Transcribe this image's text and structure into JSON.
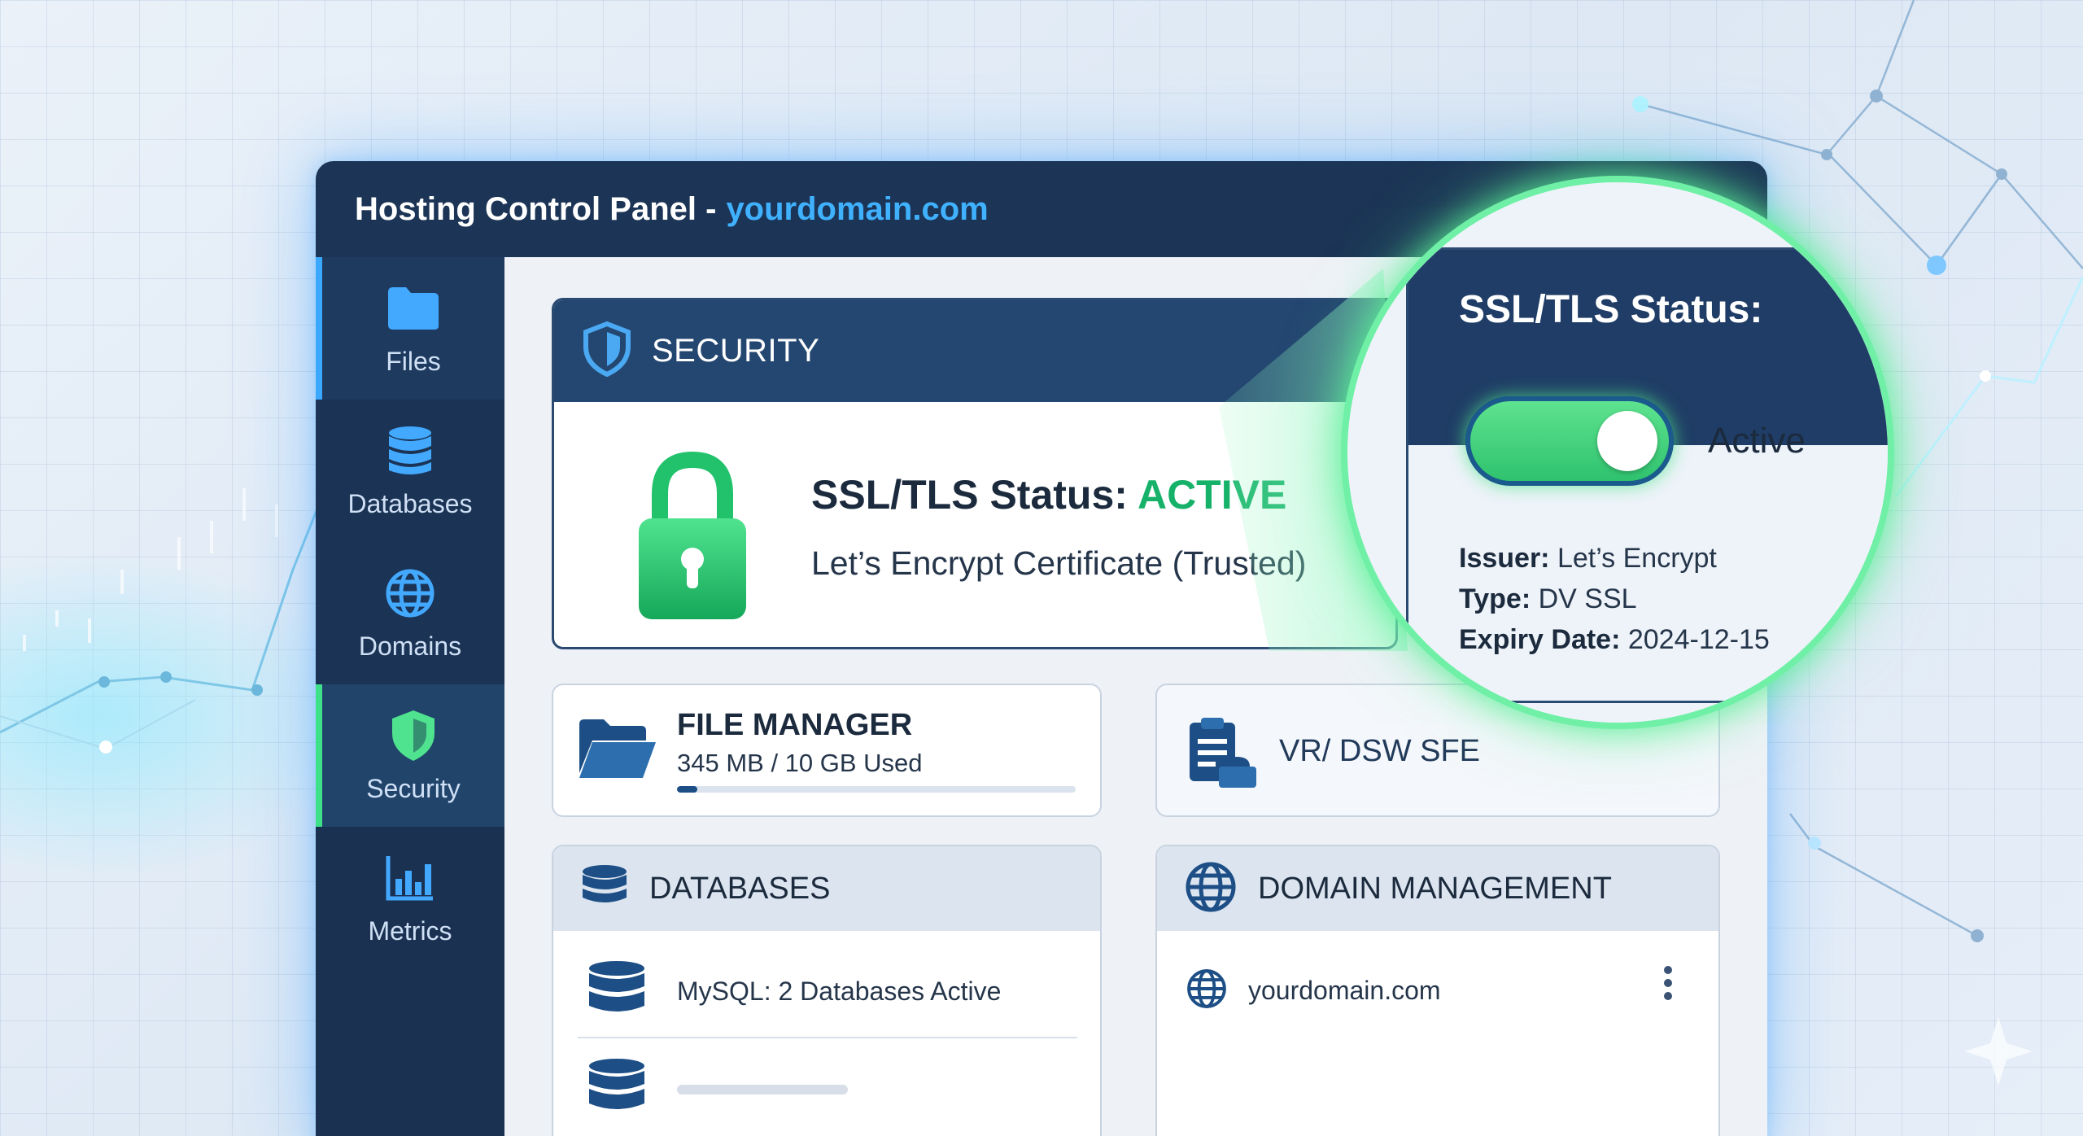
{
  "window": {
    "title": "Hosting Control Panel -",
    "domain": "yourdomain.com"
  },
  "sidebar": {
    "items": [
      {
        "label": "Files",
        "icon": "folder-icon"
      },
      {
        "label": "Databases",
        "icon": "database-icon"
      },
      {
        "label": "Domains",
        "icon": "globe-icon"
      },
      {
        "label": "Security",
        "icon": "shield-icon",
        "active": true
      },
      {
        "label": "Metrics",
        "icon": "bar-chart-icon"
      }
    ]
  },
  "security": {
    "header": "SECURITY",
    "status_label": "SSL/TLS Status:",
    "status_value": "ACTIVE",
    "certificate": "Let’s Encrypt Certificate (Trusted)"
  },
  "file_manager": {
    "title": "FILE MANAGER",
    "usage": "345 MB / 10 GB Used",
    "usage_fraction": 0.034
  },
  "vr_card": {
    "title": "VR/ DSW SFE"
  },
  "databases": {
    "header": "DATABASES",
    "rows": [
      "MySQL: 2 Databases Active"
    ]
  },
  "domain_management": {
    "header": "DOMAIN MANAGEMENT",
    "rows": [
      "yourdomain.com"
    ]
  },
  "magnifier": {
    "header": "SSL/TLS Status:",
    "toggle_label": "Active",
    "toggle_on": true,
    "issuer_label": "Issuer:",
    "issuer_value": "Let’s Encrypt",
    "type_label": "Type:",
    "type_value": "DV SSL",
    "expiry_label": "Expiry Date:",
    "expiry_value": "2024-12-15"
  },
  "colors": {
    "navy": "#1c3556",
    "accent_blue": "#3fb1ff",
    "success_green": "#17b26a",
    "glow_green": "#6ff0a6"
  }
}
